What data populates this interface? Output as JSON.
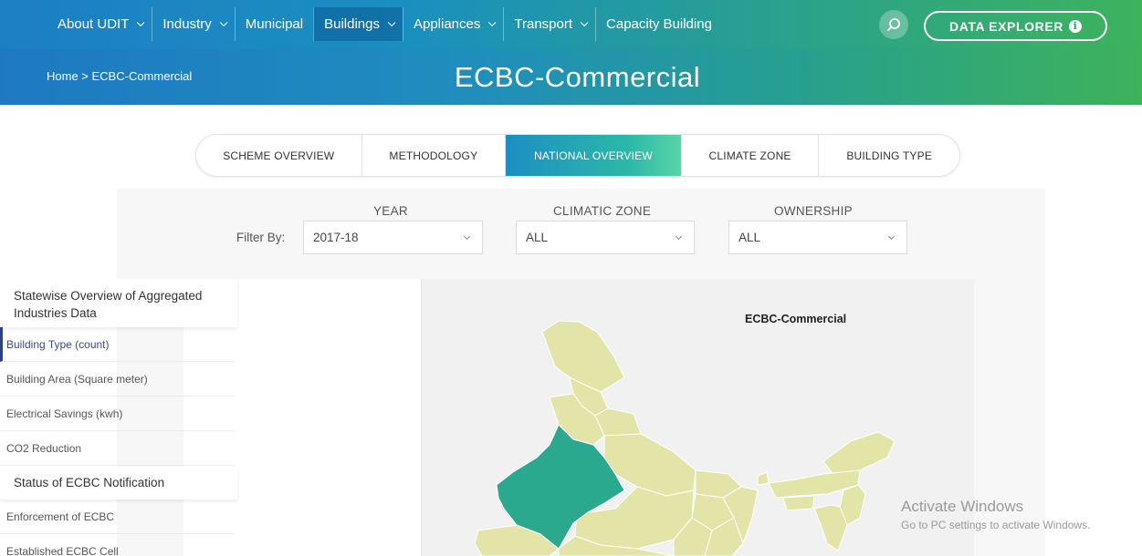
{
  "nav": {
    "items": [
      {
        "label": "About UDIT",
        "dropdown": true
      },
      {
        "label": "Industry",
        "dropdown": true
      },
      {
        "label": "Municipal",
        "dropdown": false
      },
      {
        "label": "Buildings",
        "dropdown": true
      },
      {
        "label": "Appliances",
        "dropdown": true
      },
      {
        "label": "Transport",
        "dropdown": true
      },
      {
        "label": "Capacity Building",
        "dropdown": false
      }
    ],
    "active_index": 3,
    "search_icon": "search-icon",
    "data_explorer_label": "DATA EXPLORER",
    "info_icon": "info-icon"
  },
  "hero": {
    "breadcrumb": "Home > ECBC-Commercial",
    "title": "ECBC-Commercial"
  },
  "tabs": {
    "items": [
      "SCHEME OVERVIEW",
      "METHODOLOGY",
      "NATIONAL OVERVIEW",
      "CLIMATE ZONE",
      "BUILDING TYPE"
    ],
    "active_index": 2
  },
  "filters": {
    "filter_by_label": "Filter By:",
    "year": {
      "label": "YEAR",
      "value": "2017-18"
    },
    "climatic_zone": {
      "label": "CLIMATIC ZONE",
      "value": "ALL"
    },
    "ownership": {
      "label": "OWNERSHIP",
      "value": "ALL"
    }
  },
  "sidebar": {
    "section1_title": "Statewise Overview of Aggregated Industries Data",
    "section1_items": [
      "Building Type (count)",
      "Building Area (Square meter)",
      "Electrical Savings (kwh)",
      "CO2 Reduction"
    ],
    "active_item_index": 0,
    "section2_title": "Status of ECBC Notification",
    "section2_items": [
      "Enforcement of ECBC",
      "Established ECBC Cell"
    ]
  },
  "map": {
    "title": "ECBC-Commercial",
    "base_color": "#e3e5a8",
    "highlight_color": "#2aa98e",
    "border_color": "#ffffff"
  },
  "watermark": {
    "line1": "Activate Windows",
    "line2": "Go to PC settings to activate Windows."
  },
  "colors": {
    "nav_start": "#1d7fc4",
    "nav_end": "#3db35c",
    "active_tab_start": "#1c8fc4",
    "active_tab_end": "#5ad4a8",
    "active_side_item": "#2d3f86"
  }
}
